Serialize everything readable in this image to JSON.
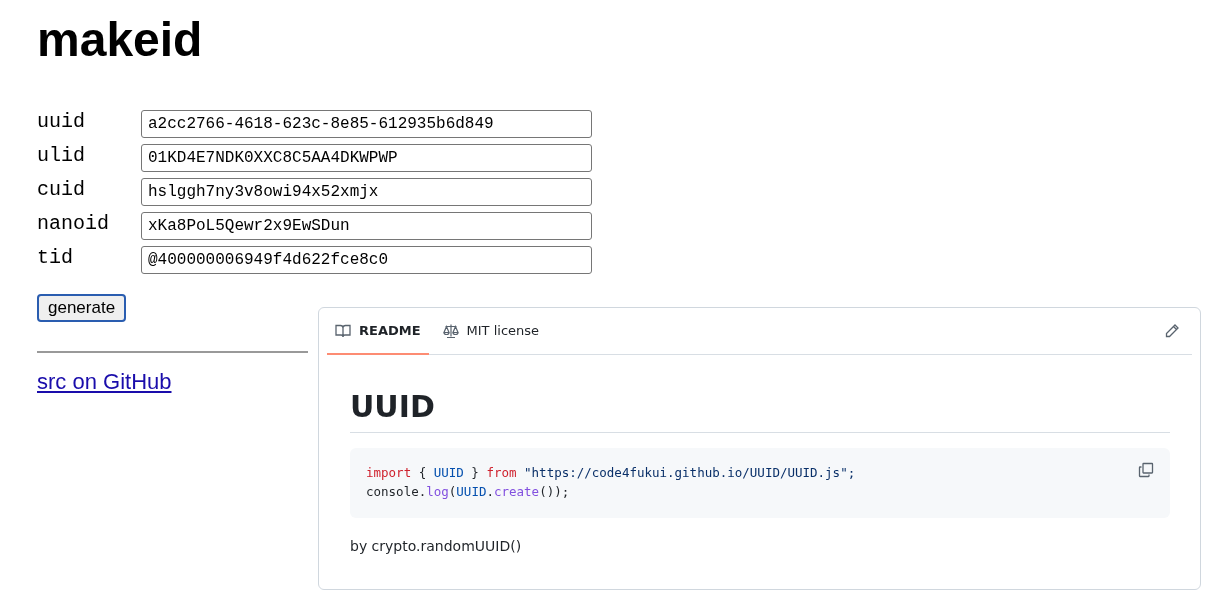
{
  "title": "makeid",
  "fields": [
    {
      "label": "uuid",
      "value": "a2cc2766-4618-623c-8e85-612935b6d849"
    },
    {
      "label": "ulid",
      "value": "01KD4E7NDK0XXC8C5AA4DKWPWP"
    },
    {
      "label": "cuid",
      "value": "hslggh7ny3v8owi94x52xmjx"
    },
    {
      "label": "nanoid",
      "value": "xKa8PoL5Qewr2x9EwSDun"
    },
    {
      "label": "tid",
      "value": "@400000006949f4d622fce8c0"
    }
  ],
  "generate_button": "generate",
  "link": "src on GitHub",
  "readme": {
    "tabs": [
      {
        "label": "README",
        "kind": "book",
        "selected": true
      },
      {
        "label": "MIT license",
        "kind": "scale",
        "selected": false
      }
    ],
    "heading": "UUID",
    "code_lines": [
      [
        {
          "text": "import",
          "kind": "keyword"
        },
        {
          "text": " { ",
          "kind": "plain"
        },
        {
          "text": "UUID",
          "kind": "constant"
        },
        {
          "text": " } ",
          "kind": "plain"
        },
        {
          "text": "from",
          "kind": "keyword"
        },
        {
          "text": " \"https://code4fukui.github.io/UUID/UUID.js\";",
          "kind": "string"
        }
      ],
      [
        {
          "text": "console.",
          "kind": "plain"
        },
        {
          "text": "log",
          "kind": "function"
        },
        {
          "text": "(",
          "kind": "plain"
        },
        {
          "text": "UUID",
          "kind": "constant"
        },
        {
          "text": ".",
          "kind": "plain"
        },
        {
          "text": "create",
          "kind": "function"
        },
        {
          "text": "());",
          "kind": "plain"
        }
      ]
    ],
    "paragraph": "by crypto.randomUUID()"
  }
}
